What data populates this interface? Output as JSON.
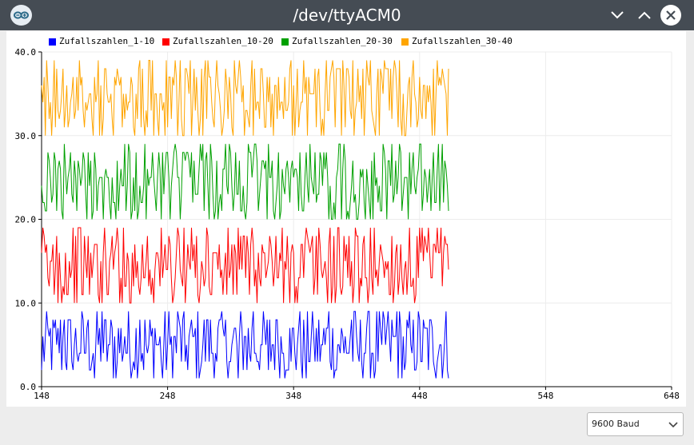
{
  "window": {
    "title": "/dev/ttyACM0",
    "titlebar_color": "#454c54"
  },
  "icons": {
    "app": "arduino-icon",
    "minimize": "chevron-down-icon",
    "maximize": "chevron-up-icon",
    "close": "close-icon"
  },
  "controls": {
    "baud_rate": "9600 Baud"
  },
  "chart_data": {
    "type": "line",
    "title": "",
    "xlabel": "",
    "ylabel": "",
    "xlim": [
      148,
      648
    ],
    "ylim": [
      0,
      40
    ],
    "x_ticks": [
      "148",
      "248",
      "348",
      "448",
      "548",
      "648"
    ],
    "y_ticks": [
      "0.0",
      "10.0",
      "20.0",
      "30.0",
      "40.0"
    ],
    "grid": true,
    "legend_position": "top-left",
    "x_start": 148,
    "x_end": 471,
    "series": [
      {
        "name": "Zufallszahlen_1-10",
        "color": "#0000ff",
        "min": 1,
        "max": 9,
        "values": [
          2,
          6,
          5,
          8,
          3,
          4,
          7,
          1,
          9,
          5,
          3,
          6,
          2,
          8,
          4,
          7,
          1,
          5,
          9,
          3,
          6,
          2,
          8,
          4,
          7,
          3,
          1,
          6,
          9,
          5,
          2,
          8,
          4,
          3,
          7,
          1,
          6,
          5,
          9,
          2,
          4,
          8,
          3,
          7,
          1,
          5,
          6,
          9,
          2,
          4
        ]
      },
      {
        "name": "Zufallszahlen_10-20",
        "color": "#ff0000",
        "min": 10,
        "max": 19,
        "values": [
          16,
          12,
          18,
          11,
          14,
          19,
          13,
          17,
          10,
          15,
          19,
          12,
          16,
          11,
          18,
          14,
          13,
          17,
          19,
          10,
          15,
          12,
          18,
          16,
          11,
          14,
          19,
          13,
          17,
          12,
          15,
          18,
          10,
          16,
          13,
          19,
          11,
          14,
          17,
          12,
          18,
          15,
          10,
          13,
          19,
          16,
          11,
          17,
          14,
          12
        ]
      },
      {
        "name": "Zufallszahlen_20-30",
        "color": "#00a000",
        "min": 20,
        "max": 29,
        "values": [
          24,
          27,
          21,
          29,
          23,
          26,
          20,
          28,
          25,
          22,
          27,
          29,
          21,
          24,
          26,
          23,
          28,
          20,
          25,
          27,
          22,
          29,
          24,
          21,
          26,
          28,
          23,
          20,
          27,
          25,
          29,
          22,
          24,
          26,
          21,
          28,
          23,
          27,
          20,
          25,
          29,
          24,
          22,
          26,
          28,
          21,
          27,
          23,
          25,
          26
        ]
      },
      {
        "name": "Zufallszahlen_30-40",
        "color": "#ffa500",
        "min": 30,
        "max": 39,
        "values": [
          36,
          32,
          38,
          31,
          35,
          39,
          33,
          37,
          30,
          34,
          38,
          32,
          36,
          39,
          31,
          35,
          33,
          37,
          30,
          38,
          34,
          32,
          39,
          36,
          31,
          35,
          37,
          33,
          30,
          38,
          34,
          36,
          32,
          39,
          31,
          37,
          35,
          30,
          33,
          38,
          36,
          32,
          34,
          39,
          31,
          37,
          33,
          35,
          30,
          37
        ]
      }
    ]
  }
}
